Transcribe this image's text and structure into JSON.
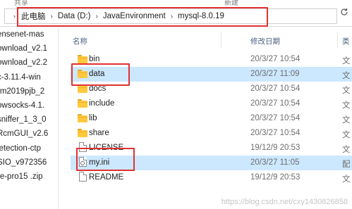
{
  "ribbon": {
    "left": "共享",
    "right": "新建"
  },
  "address_bar": {
    "crumbs": [
      "此电脑",
      "Data (D:)",
      "JavaEnvironment",
      "mysql-8.0.19"
    ]
  },
  "nav_pane": {
    "items": [
      "ensenet-mas",
      "ownload_v2.1",
      "ownload_v2.2",
      "c-3.11.4-win",
      "rm2019pjb_2",
      "owsocks-4.1.",
      "sniffer_1_3_0",
      "RcmGUI_v2.6",
      "letection-ctp",
      "SIO_v972356",
      "re-pro15 .zip"
    ]
  },
  "list_header": {
    "name": "名称",
    "date": "修改日期",
    "type": "类"
  },
  "files": [
    {
      "name": "bin",
      "date": "20/3/27 10:54",
      "type": "文",
      "icon": "folder-icon",
      "selected": false
    },
    {
      "name": "data",
      "date": "20/3/27 11:09",
      "type": "文",
      "icon": "folder-icon",
      "selected": true
    },
    {
      "name": "docs",
      "date": "20/3/27 10:54",
      "type": "文",
      "icon": "folder-icon",
      "selected": false
    },
    {
      "name": "include",
      "date": "20/3/27 10:54",
      "type": "文",
      "icon": "folder-icon",
      "selected": false
    },
    {
      "name": "lib",
      "date": "20/3/27 10:54",
      "type": "文",
      "icon": "folder-icon",
      "selected": false
    },
    {
      "name": "share",
      "date": "20/3/27 10:54",
      "type": "文",
      "icon": "folder-icon",
      "selected": false
    },
    {
      "name": "LICENSE",
      "date": "19/12/9 20:53",
      "type": "文",
      "icon": "file-icon",
      "selected": false
    },
    {
      "name": "my.ini",
      "date": "20/3/27 11:05",
      "type": "配",
      "icon": "settings-file-icon",
      "selected": true
    },
    {
      "name": "README",
      "date": "19/12/9 20:53",
      "type": "文",
      "icon": "file-icon",
      "selected": false
    }
  ],
  "watermark": "https://blog.csdn.net/cxy1430826858",
  "colors": {
    "selection": "#cce8ff",
    "annotation": "#e03232",
    "folder": "#ffc83d"
  }
}
